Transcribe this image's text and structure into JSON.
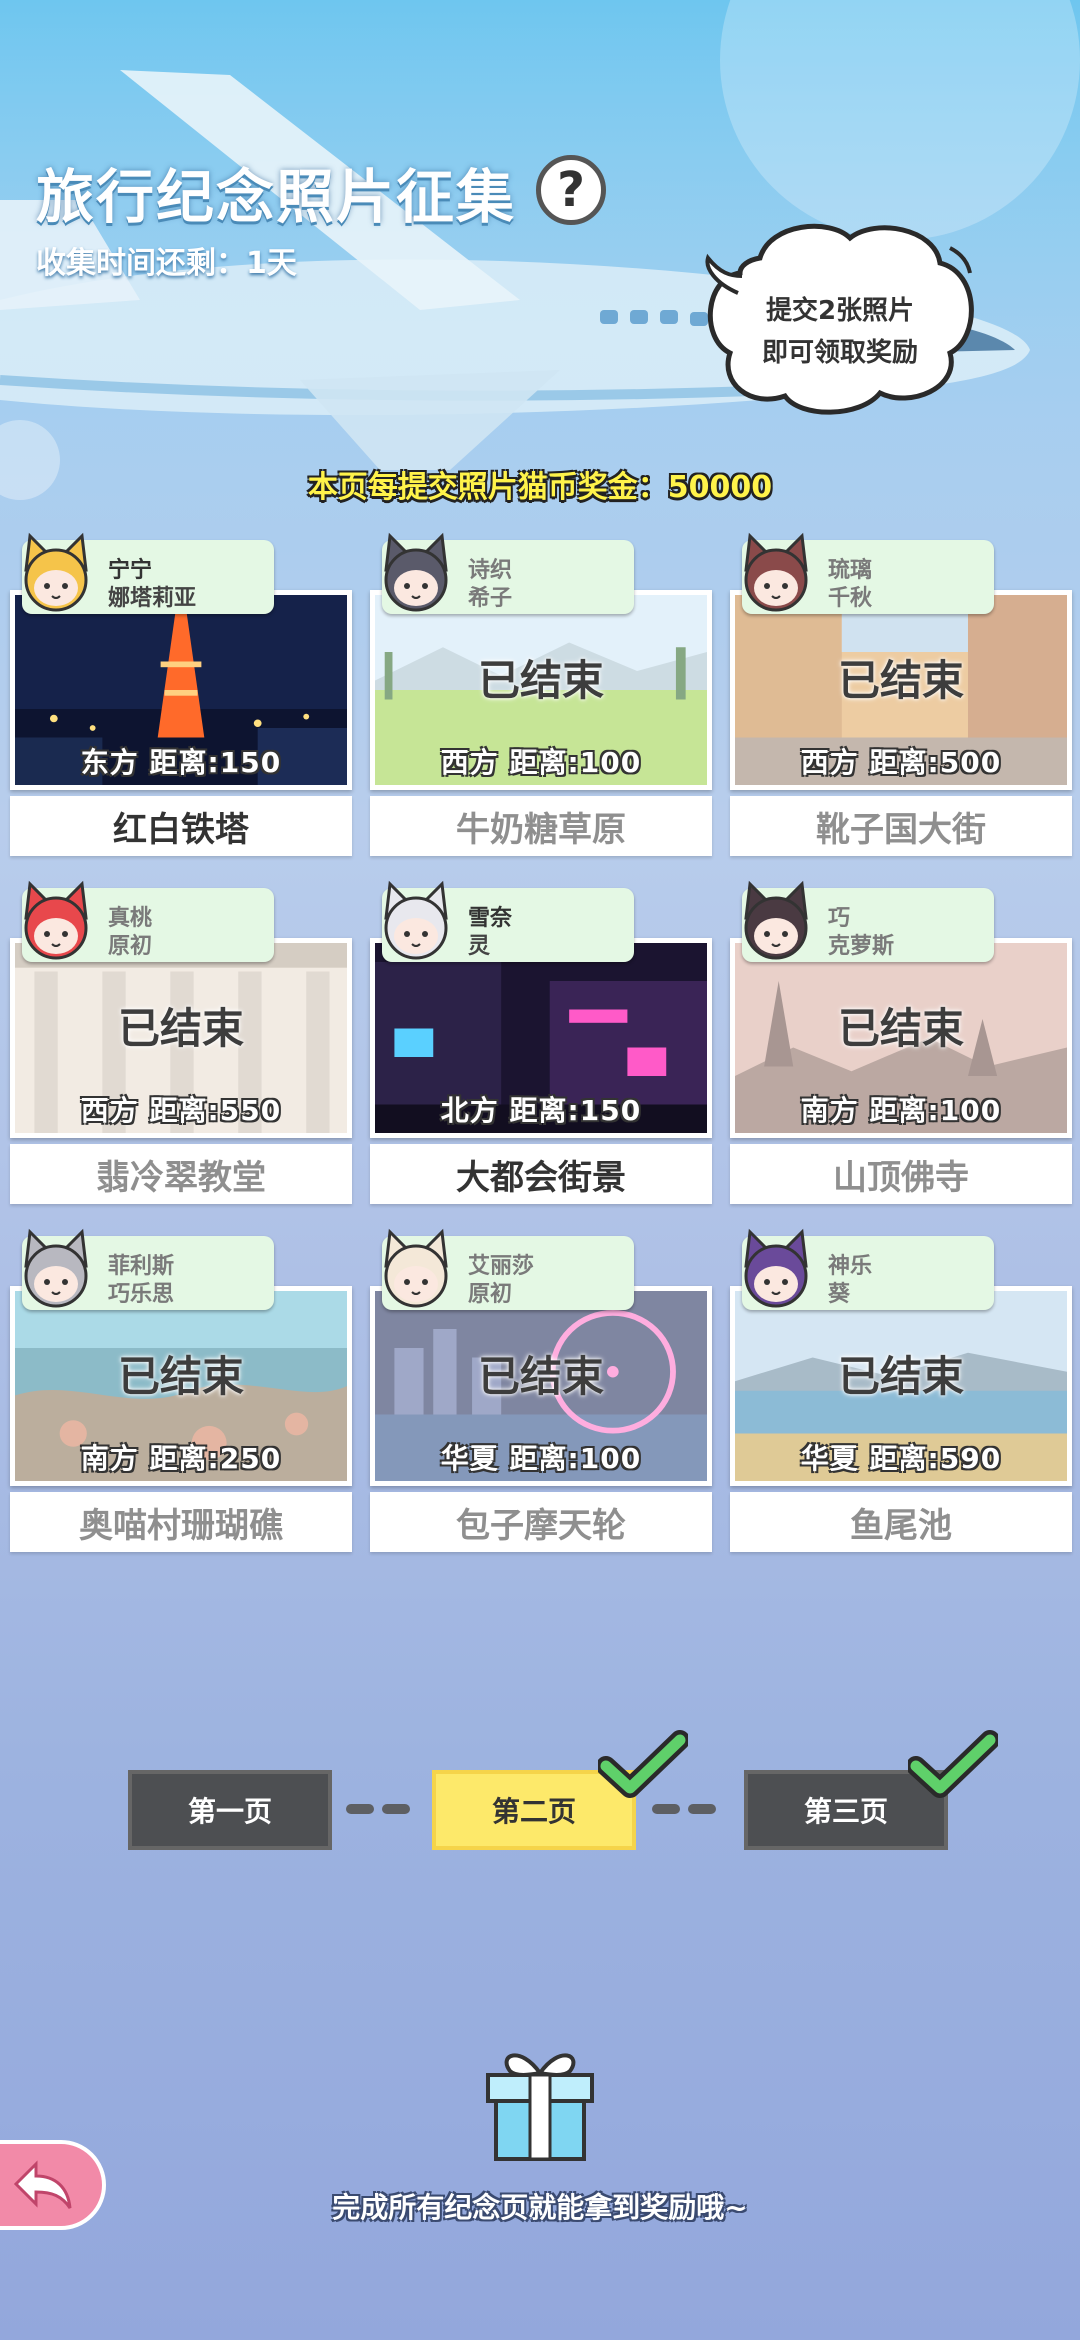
{
  "header": {
    "title": "旅行纪念照片征集",
    "help_icon": "?",
    "time_left": "收集时间还剩：1天",
    "bubble_line1": "提交2张照片",
    "bubble_line2": "即可领取奖励",
    "bonus": "本页每提交照片猫币奖金：50000"
  },
  "ended_label": "已结束",
  "spots": [
    {
      "name1": "宁宁",
      "name2": "娜塔莉亚",
      "distance": "东方 距离:150",
      "place": "红白铁塔",
      "ended": false,
      "avatar_color": "#f5c44a",
      "scene": "tower"
    },
    {
      "name1": "诗织",
      "name2": "希子",
      "distance": "西方 距离:100",
      "place": "牛奶糖草原",
      "ended": true,
      "avatar_color": "#5a5a6a",
      "scene": "meadow"
    },
    {
      "name1": "琉璃",
      "name2": "千秋",
      "distance": "西方 距离:500",
      "place": "靴子国大街",
      "ended": true,
      "avatar_color": "#8a4a4a",
      "scene": "street"
    },
    {
      "name1": "真桃",
      "name2": "原初",
      "distance": "西方 距离:550",
      "place": "翡冷翠教堂",
      "ended": true,
      "avatar_color": "#e8484c",
      "scene": "church"
    },
    {
      "name1": "雪奈",
      "name2": "灵",
      "distance": "北方 距离:150",
      "place": "大都会街景",
      "ended": false,
      "avatar_color": "#e8e8ee",
      "scene": "city"
    },
    {
      "name1": "巧",
      "name2": "克萝斯",
      "distance": "南方 距离:100",
      "place": "山顶佛寺",
      "ended": true,
      "avatar_color": "#4a3a42",
      "scene": "temple"
    },
    {
      "name1": "菲利斯",
      "name2": "巧乐思",
      "distance": "南方 距离:250",
      "place": "奥喵村珊瑚礁",
      "ended": true,
      "avatar_color": "#b8b8c0",
      "scene": "reef"
    },
    {
      "name1": "艾丽莎",
      "name2": "原初",
      "distance": "华夏 距离:100",
      "place": "包子摩天轮",
      "ended": true,
      "avatar_color": "#f4e8d8",
      "scene": "wheel"
    },
    {
      "name1": "神乐",
      "name2": "葵",
      "distance": "华夏 距离:590",
      "place": "鱼尾池",
      "ended": true,
      "avatar_color": "#6a4a9a",
      "scene": "lake"
    }
  ],
  "pages": {
    "page1": "第一页",
    "page2": "第二页",
    "page3": "第三页",
    "active": 2,
    "completed": [
      2,
      3
    ]
  },
  "footer": {
    "reward_text": "完成所有纪念页就能拿到奖励哦~"
  },
  "icons": {
    "help": "question-icon",
    "gift": "gift-icon",
    "back": "back-arrow-icon",
    "check": "checkmark-icon"
  },
  "colors": {
    "active_page": "#fde96a",
    "page_dark": "#4d4f52",
    "tag_bg": "#e4f8e4",
    "check": "#5fd06a",
    "back_button": "#f28aa8"
  }
}
